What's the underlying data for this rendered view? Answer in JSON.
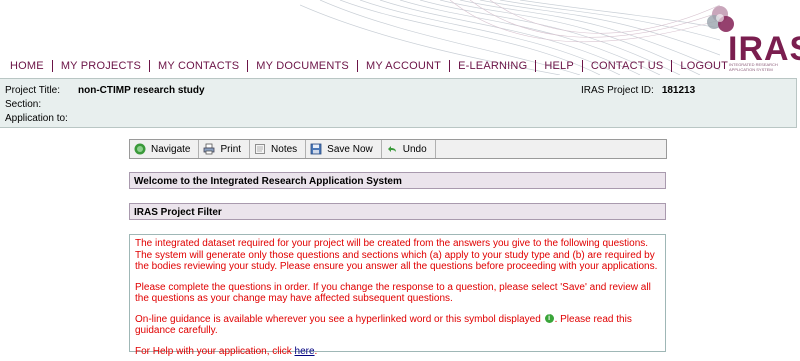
{
  "brand": {
    "logo": "IRAS",
    "subtitle": "INTEGRATED RESEARCH APPLICATION SYSTEM",
    "accent": "#6b1346"
  },
  "nav": {
    "items": [
      {
        "label": "HOME"
      },
      {
        "label": "MY PROJECTS"
      },
      {
        "label": "MY CONTACTS"
      },
      {
        "label": "MY DOCUMENTS"
      },
      {
        "label": "MY ACCOUNT"
      },
      {
        "label": "E-LEARNING"
      },
      {
        "label": "HELP"
      },
      {
        "label": "CONTACT US"
      },
      {
        "label": "LOGOUT"
      }
    ]
  },
  "project": {
    "title_label": "Project Title:",
    "title_value": "non-CTIMP research study",
    "section_label": "Section:",
    "application_label": "Application to:",
    "id_label": "IRAS Project ID:",
    "id_value": "181213"
  },
  "toolbar": {
    "navigate": "Navigate",
    "print": "Print",
    "notes": "Notes",
    "save_now": "Save Now",
    "undo": "Undo"
  },
  "panels": {
    "welcome": "Welcome to the Integrated Research Application System",
    "filter": "IRAS Project Filter"
  },
  "content": {
    "para1": "The integrated dataset required for your project will be created from the answers you give to the following questions. The system will generate only those questions and sections which (a) apply to your study type and (b) are required by the bodies reviewing your study. Please ensure you answer all the questions before proceeding with your applications.",
    "para2": "Please complete the questions in order. If you change the response to a question, please select 'Save' and review all the questions as your change may have affected subsequent questions.",
    "para3_before": "On-line guidance is available wherever you see a hyperlinked word or this symbol displayed",
    "para3_icon": "i",
    "para3_after": ". Please read this guidance carefully.",
    "para4_before": "For Help with your application, click",
    "para4_link": "here",
    "para4_after": "."
  }
}
